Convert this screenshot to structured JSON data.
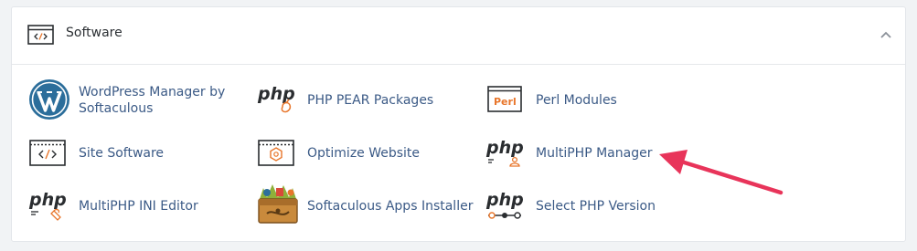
{
  "section": {
    "title": "Software",
    "header_icon": "code-window-icon",
    "toggle_icon": "chevron-up-icon"
  },
  "tools": {
    "wordpress_manager": {
      "label": "WordPress Manager by Softaculous",
      "icon": "wordpress-icon"
    },
    "php_pear": {
      "label": "PHP PEAR Packages",
      "icon": "php-pear-icon"
    },
    "perl_modules": {
      "label": "Perl Modules",
      "icon": "perl-icon",
      "icon_text": "Perl"
    },
    "site_software": {
      "label": "Site Software",
      "icon": "code-window-icon"
    },
    "optimize_website": {
      "label": "Optimize Website",
      "icon": "optimize-icon"
    },
    "multiphp_manager": {
      "label": "MultiPHP Manager",
      "icon": "php-manager-icon"
    },
    "multiphp_ini": {
      "label": "MultiPHP INI Editor",
      "icon": "php-ini-icon"
    },
    "softaculous": {
      "label": "Softaculous Apps Installer",
      "icon": "softaculous-icon"
    },
    "select_php": {
      "label": "Select PHP Version",
      "icon": "php-version-icon"
    }
  },
  "php_glyph": "php",
  "annotation": {
    "type": "arrow",
    "color": "#e8345a",
    "points_to": "MultiPHP Manager"
  },
  "colors": {
    "label": "#3b5a86",
    "icon_dark": "#2a2d30",
    "icon_accent": "#e8762b",
    "wordpress_blue": "#2c6e9b"
  }
}
